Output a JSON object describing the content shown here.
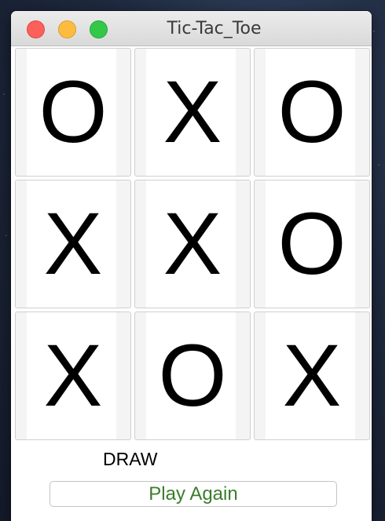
{
  "window": {
    "title": "Tic-Tac_Toe"
  },
  "board": {
    "cells": [
      "O",
      "X",
      "O",
      "X",
      "X",
      "O",
      "X",
      "O",
      "X"
    ]
  },
  "status_text": "DRAW",
  "play_again_label": "Play Again",
  "colors": {
    "close": "#fc605b",
    "minimize": "#fdbc40",
    "maximize": "#34c84a",
    "play_again_text": "#3a7d2a"
  }
}
